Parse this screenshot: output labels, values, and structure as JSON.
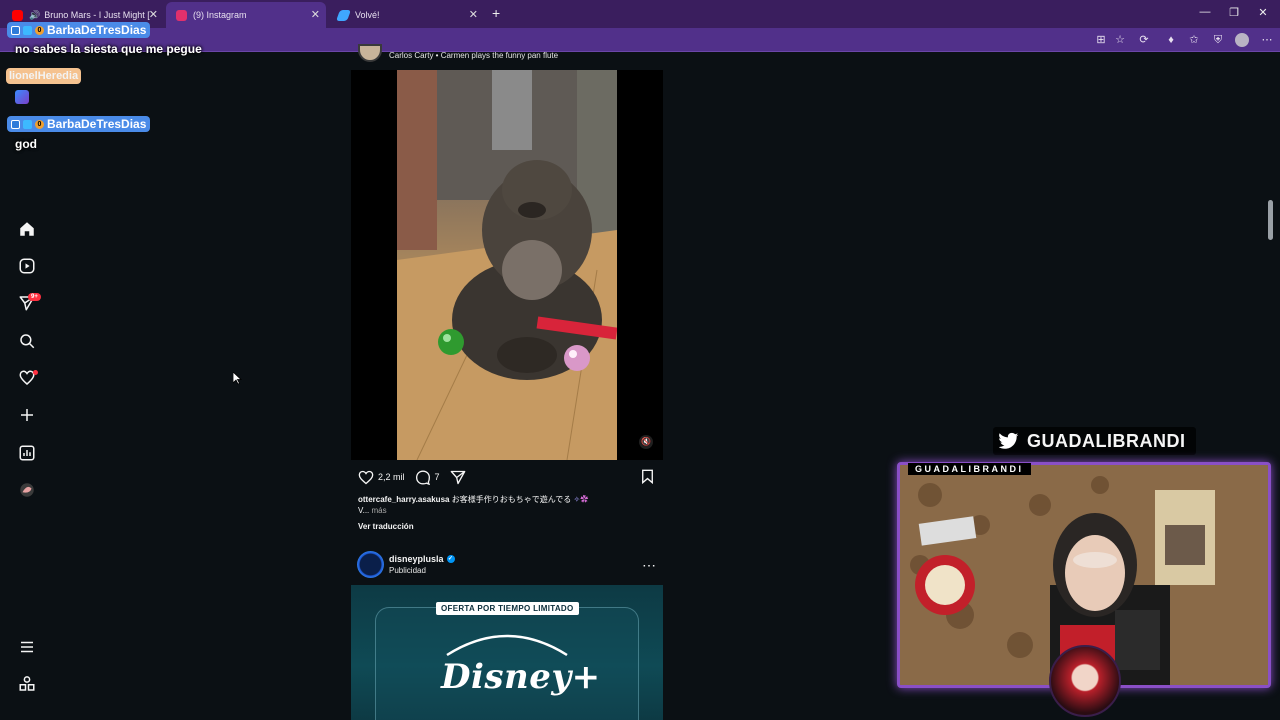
{
  "browser": {
    "tabs": [
      {
        "title": "Bruno Mars - I Just Might [Of",
        "favicon_color": "#ff0000"
      },
      {
        "title": "(9) Instagram",
        "favicon_color": "#e1306c"
      },
      {
        "title": "Volvé!",
        "favicon_color": "#3fa7ff"
      }
    ],
    "new_tab": "+"
  },
  "chat": {
    "messages": [
      {
        "user": "BarbaDeTresDias",
        "text": "no sabes la siesta que me pegue",
        "badge_number": "0"
      },
      {
        "user": "lionelHeredia",
        "text": ""
      },
      {
        "user": "BarbaDeTresDias",
        "text": "god",
        "badge_number": "0"
      }
    ]
  },
  "sidebar": {
    "items": [
      {
        "name": "home",
        "icon": "home-icon"
      },
      {
        "name": "reels",
        "icon": "reels-icon"
      },
      {
        "name": "messages",
        "icon": "send-icon",
        "badge": "9+"
      },
      {
        "name": "search",
        "icon": "search-icon"
      },
      {
        "name": "notifications",
        "icon": "heart-icon"
      },
      {
        "name": "create",
        "icon": "plus-icon"
      },
      {
        "name": "dashboard",
        "icon": "chart-icon"
      },
      {
        "name": "profile",
        "icon": "avatar-icon"
      },
      {
        "name": "more",
        "icon": "menu-icon"
      },
      {
        "name": "also-from-meta",
        "icon": "grid-icon"
      }
    ]
  },
  "post1": {
    "header": "Carlos Carty • Carmen plays the funny pan flute",
    "likes": "2,2 mil",
    "comments": "7",
    "caption_user": "ottercafe_harry.asakusa",
    "caption_text": "お客様手作りおもちゃで遊んでる",
    "caption_more_prefix": "V...",
    "caption_more": "más",
    "translate": "Ver traducción"
  },
  "post2": {
    "username": "disneyplusla",
    "sponsored": "Publicidad",
    "ad_banner": "OFERTA POR TIEMPO LIMITADO",
    "ad_logo": "Disney+"
  },
  "stream": {
    "twitter_handle": "GUADALIBRANDI",
    "cam_label": "GUADALIBRANDI"
  }
}
